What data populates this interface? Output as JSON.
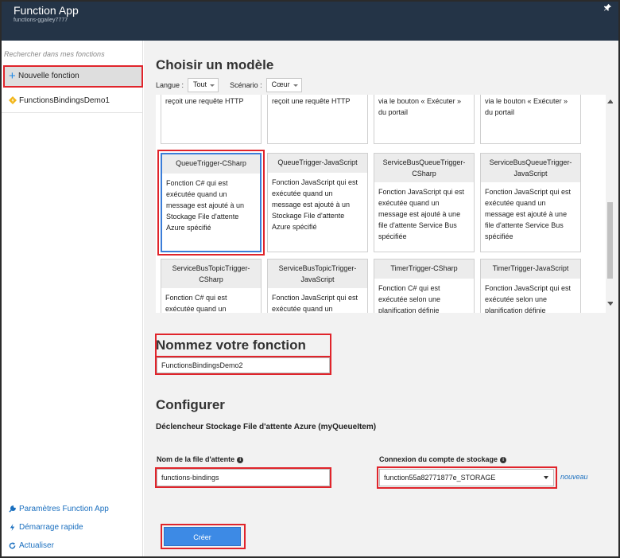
{
  "header": {
    "title": "Function App",
    "subtitle": "functions-ggailey7777",
    "pin_icon": "pin-icon"
  },
  "sidebar": {
    "search_placeholder": "Rechercher dans mes fonctions",
    "new_function_label": "Nouvelle fonction",
    "functions": [
      {
        "label": "FunctionsBindingsDemo1",
        "icon": "function-bolt-icon"
      }
    ],
    "bottom_links": [
      {
        "label": "Paramètres Function App",
        "icon": "wrench-icon"
      },
      {
        "label": "Démarrage rapide",
        "icon": "bolt-icon"
      },
      {
        "label": "Actualiser",
        "icon": "refresh-icon"
      }
    ]
  },
  "main": {
    "choose_template_title": "Choisir un modèle",
    "language_label": "Langue :",
    "language_value": "Tout",
    "scenario_label": "Scénario :",
    "scenario_value": "Cœur",
    "templates": [
      {
        "title": "",
        "desc": "reçoit une requête HTTP"
      },
      {
        "title": "",
        "desc": "reçoit une requête HTTP"
      },
      {
        "title": "",
        "desc": "via le bouton « Exécuter » du portail"
      },
      {
        "title": "",
        "desc": "via le bouton « Exécuter » du portail"
      },
      {
        "title": "QueueTrigger-CSharp",
        "desc": "Fonction C# qui est exécutée quand un message est ajouté à un Stockage File d'attente Azure spécifié",
        "selected": true
      },
      {
        "title": "QueueTrigger-JavaScript",
        "desc": "Fonction JavaScript qui est exécutée quand un message est ajouté à un Stockage File d'attente Azure spécifié"
      },
      {
        "title": "ServiceBusQueueTrigger-CSharp",
        "desc": "Fonction JavaScript qui est exécutée quand un message est ajouté à une file d'attente Service Bus spécifiée"
      },
      {
        "title": "ServiceBusQueueTrigger-JavaScript",
        "desc": "Fonction JavaScript qui est exécutée quand un message est ajouté à une file d'attente Service Bus spécifiée"
      },
      {
        "title": "ServiceBusTopicTrigger-CSharp",
        "desc": "Fonction C# qui est exécutée quand un"
      },
      {
        "title": "ServiceBusTopicTrigger-JavaScript",
        "desc": "Fonction JavaScript qui est exécutée quand un"
      },
      {
        "title": "TimerTrigger-CSharp",
        "desc": "Fonction C# qui est exécutée selon une planification définie"
      },
      {
        "title": "TimerTrigger-JavaScript",
        "desc": "Fonction JavaScript qui est exécutée selon une planification définie"
      }
    ],
    "name_section_title": "Nommez votre fonction",
    "function_name_value": "FunctionsBindingsDemo2",
    "configure_title": "Configurer",
    "trigger_heading": "Déclencheur Stockage File d'attente Azure (myQueueItem)",
    "queue_name_label": "Nom de la file d'attente",
    "queue_name_value": "functions-bindings",
    "storage_conn_label": "Connexion du compte de stockage",
    "storage_conn_value": "function55a82771877e_STORAGE",
    "new_link": "nouveau",
    "create_button": "Créer"
  }
}
